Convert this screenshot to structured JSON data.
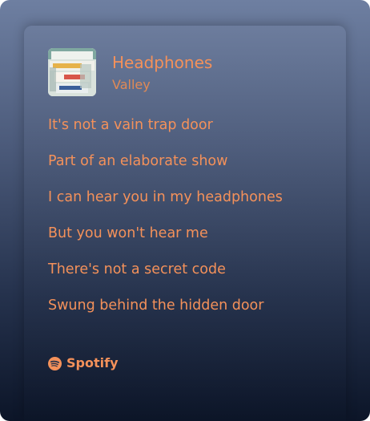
{
  "track": {
    "title": "Headphones",
    "artist": "Valley"
  },
  "lyrics": [
    "It's not a vain trap door",
    "Part of an elaborate show",
    "I can hear you in my headphones",
    "But you won't hear me",
    "There's not a secret code",
    "Swung behind the hidden door"
  ],
  "footer": {
    "brand_label": "Spotify",
    "brand_icon": "spotify-icon"
  },
  "colors": {
    "accent": "#f4915a",
    "background_top": "#6e7fa1",
    "background_bottom": "#0c1528"
  }
}
